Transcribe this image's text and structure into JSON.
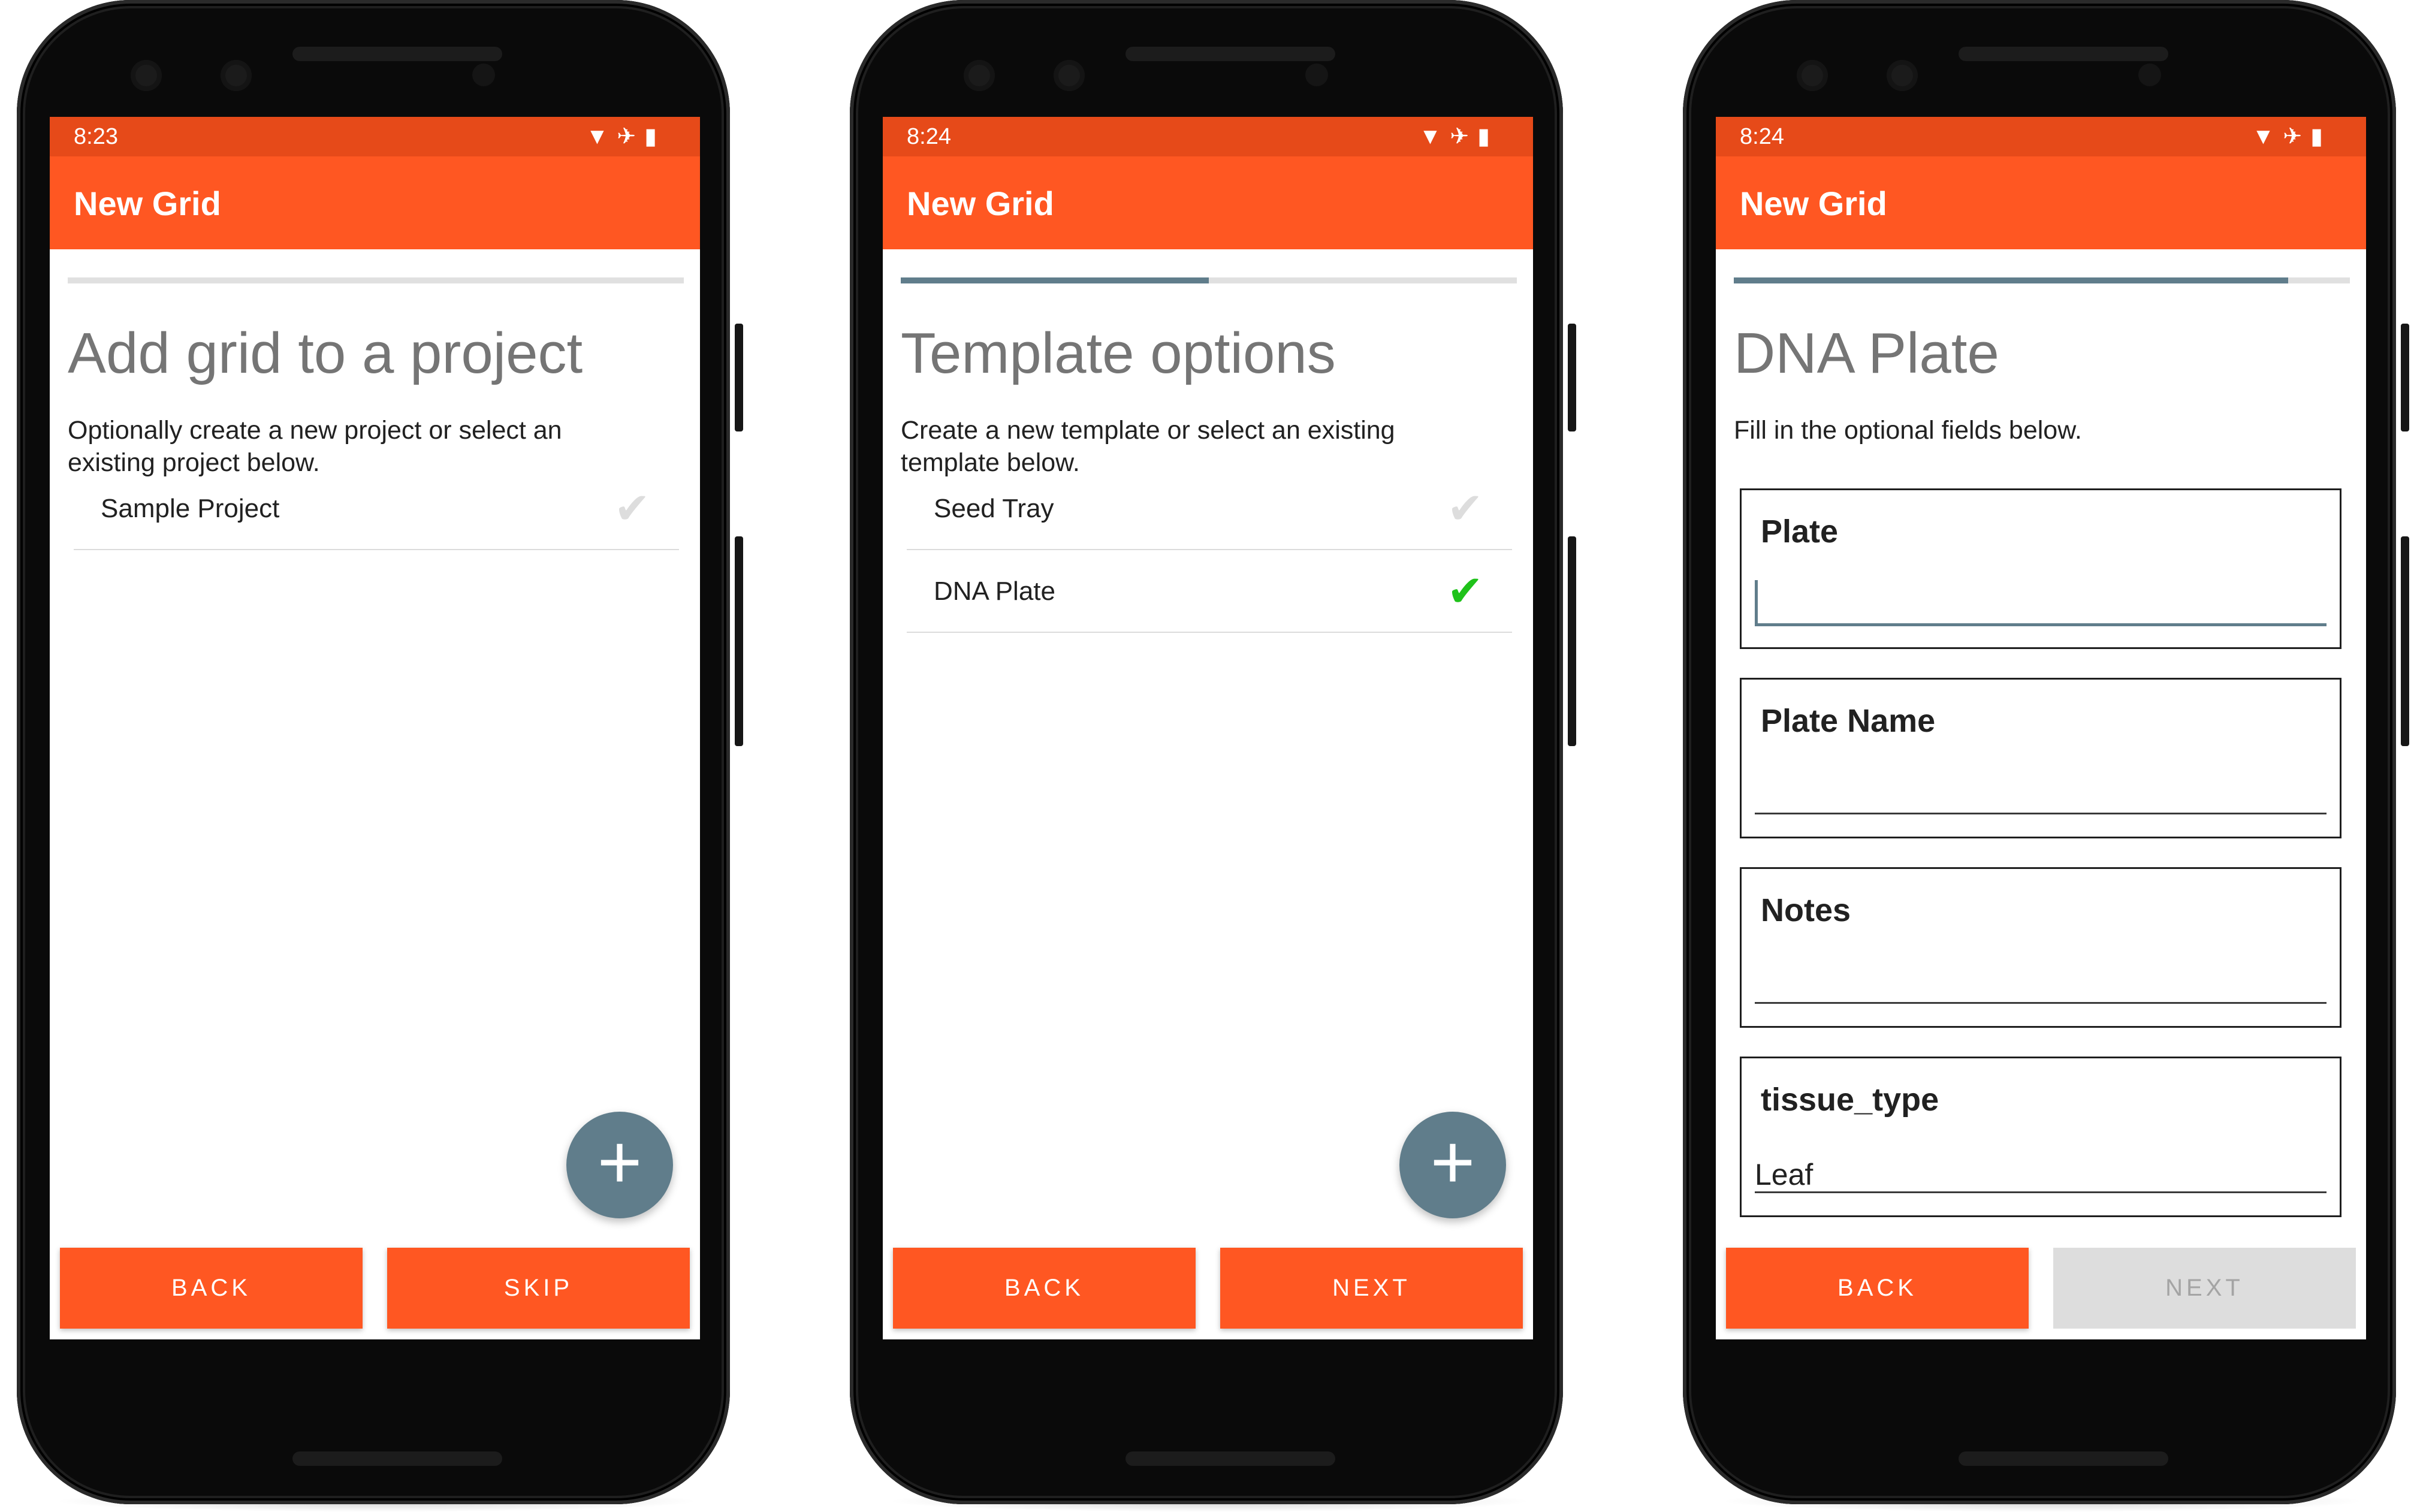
{
  "phones": [
    {
      "status_time": "8:23",
      "app_title": "New Grid",
      "progress": 0,
      "heading": "Add grid to a project",
      "description": "Optionally create a new project or select an existing project below.",
      "list": [
        {
          "label": "Sample Project",
          "checked": false
        }
      ],
      "buttons": {
        "left": "BACK",
        "right": "SKIP",
        "right_enabled": true
      }
    },
    {
      "status_time": "8:24",
      "app_title": "New Grid",
      "progress": 0.5,
      "heading": "Template options",
      "description": "Create a new template or select an existing template below.",
      "list": [
        {
          "label": "Seed Tray",
          "checked": false
        },
        {
          "label": "DNA Plate",
          "checked": true
        }
      ],
      "buttons": {
        "left": "BACK",
        "right": "NEXT",
        "right_enabled": true
      }
    },
    {
      "status_time": "8:24",
      "app_title": "New Grid",
      "progress": 0.9,
      "heading": "DNA Plate",
      "description": "Fill in the optional fields below.",
      "fields": [
        {
          "label": "Plate",
          "value": "",
          "focused": true
        },
        {
          "label": "Plate Name",
          "value": "",
          "focused": false
        },
        {
          "label": "Notes",
          "value": "",
          "focused": false
        },
        {
          "label": "tissue_type",
          "value": "Leaf",
          "focused": false
        }
      ],
      "buttons": {
        "left": "BACK",
        "right": "NEXT",
        "right_enabled": false
      }
    }
  ],
  "icons": {
    "status": [
      "wifi-icon",
      "airplane-icon",
      "battery-icon"
    ],
    "fab": "add-icon",
    "check": "check-icon",
    "nav": [
      "back-icon",
      "home-icon",
      "recents-icon"
    ]
  },
  "colors": {
    "status_bar": "#e64a19",
    "app_bar": "#ff5722",
    "accent": "#607d8b",
    "check_on": "#1fc21a",
    "check_off": "#dddddd",
    "button_disabled": "#dddddd"
  }
}
